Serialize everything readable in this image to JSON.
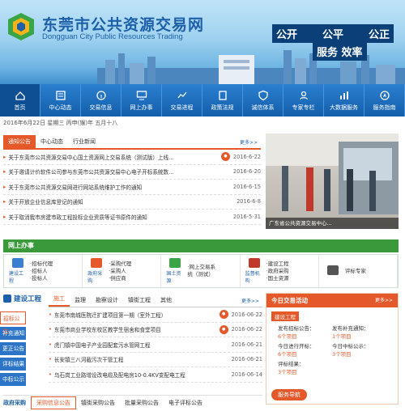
{
  "header": {
    "title_cn": "东莞市公共资源交易网",
    "title_en": "Dongguan City Public Resources Trading",
    "slogan_1": [
      "公开",
      "公平",
      "公正"
    ],
    "slogan_2": "服务 效率"
  },
  "nav": [
    {
      "label": "首页",
      "icon": "home-icon"
    },
    {
      "label": "中心动态",
      "icon": "news-icon"
    },
    {
      "label": "交易信息",
      "icon": "info-icon"
    },
    {
      "label": "网上办事",
      "icon": "computer-icon"
    },
    {
      "label": "交易进程",
      "icon": "process-icon"
    },
    {
      "label": "政策法规",
      "icon": "book-icon"
    },
    {
      "label": "诚信体系",
      "icon": "shield-icon"
    },
    {
      "label": "专家专栏",
      "icon": "expert-icon"
    },
    {
      "label": "大数据服务",
      "icon": "data-icon"
    },
    {
      "label": "服务指南",
      "icon": "guide-icon"
    }
  ],
  "datebar": "2016年6月22日  星期三  丙申(猴)年 五月十八",
  "notice": {
    "tabs": [
      "通知公告",
      "中心动态",
      "行业新闻"
    ],
    "more": "更多>>",
    "items": [
      {
        "text": "关于东莞市公共资源交易中心国土资源网上交易系统（测试版）上线...",
        "date": "2016-6-22",
        "hot": true
      },
      {
        "text": "关于邀请计价软件公司参与东莞市公共资源交易中心电子开标系统数...",
        "date": "2016-6-20",
        "hot": false
      },
      {
        "text": "关于东莞市公共资源交易网进行网站系统维护工作的通知",
        "date": "2016-6-15",
        "hot": false
      },
      {
        "text": "关于开放企业信息库登记的通知",
        "date": "2016-6-8",
        "hot": false
      },
      {
        "text": "关于取消我市房建市政工程投标企业资质等证书原件的通知",
        "date": "2016-5-31",
        "hot": false
      }
    ]
  },
  "photo_caption": "广东省公共资源交易中心...",
  "online": {
    "title": "网上办事",
    "sections": [
      {
        "icon_label": "建设工程",
        "lines": [
          "·招标代理",
          "·招标人",
          "·投标人"
        ]
      },
      {
        "icon_label": "政府采购",
        "lines": [
          "·采购代理",
          "·采购人",
          "·供应商"
        ]
      },
      {
        "icon_label": "国土资源",
        "lines": [
          "·网上交易系",
          "统（测试）"
        ]
      },
      {
        "icon_label": "监督机构",
        "lines": [
          "·建设工程",
          "·政府采购",
          "·国土资源"
        ]
      },
      {
        "icon_label": "",
        "lines": [
          "评标专家"
        ]
      }
    ]
  },
  "construction": {
    "title": "建设工程",
    "tabs": [
      "施工",
      "监理",
      "勘察设计",
      "镇街工程",
      "其他"
    ],
    "more": "更多>>",
    "left_nav": [
      "招标公告",
      "补充通知",
      "更正公告",
      "评标结果",
      "中标公示"
    ],
    "items": [
      {
        "text": "东莞市南城医院迁扩建项目第一期（室外工程）",
        "date": "2016-06-22",
        "hot": true
      },
      {
        "text": "东莞市商业学校东校区教学生宿舍和食堂项目",
        "date": "2016-06-22",
        "hot": true
      },
      {
        "text": "虎门镇中国电子产业园配套污水管网工程",
        "date": "2016-06-21",
        "hot": false
      },
      {
        "text": "长安镇三八河截污次干管工程",
        "date": "2016-06-21",
        "hot": false
      },
      {
        "text": "乌石岗工业路增设改电缆及配电房10-0.4KV变配电工程",
        "date": "2016-06-14",
        "hot": false
      }
    ]
  },
  "today": {
    "title": "今日交易活动",
    "more": "更多>>",
    "sub": "建设工程",
    "cells": [
      {
        "label": "发布招标公告：",
        "value": "6个项目"
      },
      {
        "label": "发布补充通知：",
        "value": "1个项目"
      },
      {
        "label": "今日进行开标：",
        "value": "6个项目"
      },
      {
        "label": "今日中标公示：",
        "value": "3个项目"
      },
      {
        "label": "评标结果：",
        "value": "3个项目"
      },
      {
        "label": "",
        "value": ""
      }
    ],
    "service": "服务导航"
  },
  "bottom": {
    "title": "政府采购",
    "tabs": [
      "采购信息公告",
      "镇街采购公告",
      "批量采购公告",
      "电子评标公告"
    ]
  }
}
